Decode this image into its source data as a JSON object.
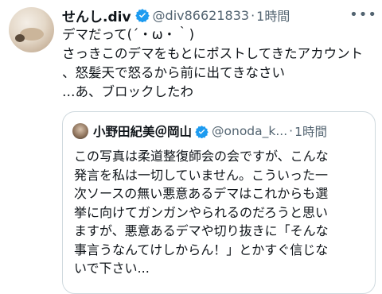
{
  "tweet": {
    "display_name": "せんし.div",
    "handle": "@div86621833",
    "separator": "·",
    "time": "1時間",
    "more_icon": "more-horizontal-icon",
    "lines": [
      "デマだって(´・ω・｀)",
      "さっきこのデマをもとにポストしてきたアカウント",
      "、怒髪天で怒るから前に出てきなさい",
      "…あ、ブロックしたわ"
    ]
  },
  "quoted": {
    "display_name": "小野田紀美＠岡山",
    "handle": "@onoda_k...",
    "separator": "·",
    "time": "1時間",
    "lines": [
      "この写真は柔道整復師会の会ですが、こんな",
      "発言を私は一切していません。こういった一",
      "次ソースの無い悪意あるデマはこれからも選",
      "挙に向けてガンガンやられるのだろうと思い",
      "ますが、悪意あるデマや切り抜きに「そんな",
      "事言うなんてけしからん！」とかすぐ信じな",
      "いで下さい..."
    ]
  },
  "colors": {
    "verified": "#1d9bf0",
    "secondary_text": "#536471",
    "border": "#cfd9de"
  }
}
